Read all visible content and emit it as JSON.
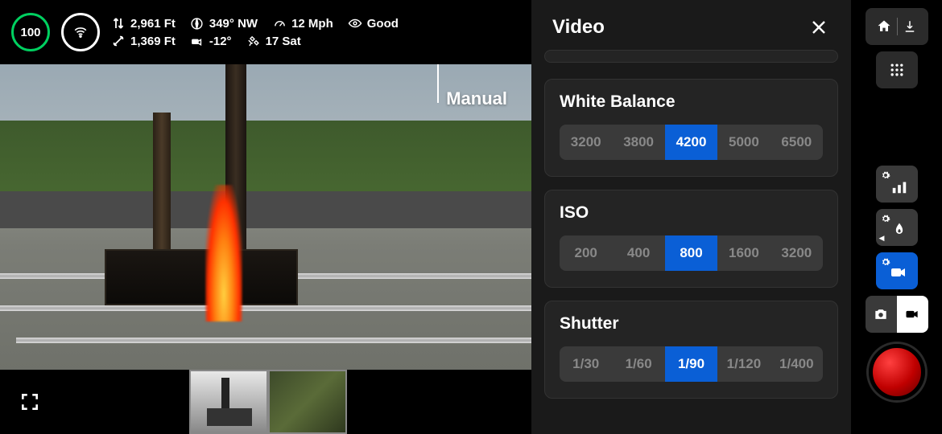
{
  "telemetry": {
    "battery": "100",
    "altitude": "2,961 Ft",
    "distance": "1,369 Ft",
    "heading": "349° NW",
    "gimbal": "-12°",
    "speed": "12 Mph",
    "satellites": "17 Sat",
    "signal": "Good"
  },
  "feed": {
    "mode_label": "Manual"
  },
  "panel": {
    "title": "Video",
    "groups": {
      "white_balance": {
        "label": "White Balance",
        "options": [
          "3200",
          "3800",
          "4200",
          "5000",
          "6500"
        ],
        "selected": "4200"
      },
      "iso": {
        "label": "ISO",
        "options": [
          "200",
          "400",
          "800",
          "1600",
          "3200"
        ],
        "selected": "800"
      },
      "shutter": {
        "label": "Shutter",
        "options": [
          "1/30",
          "1/60",
          "1/90",
          "1/120",
          "1/400"
        ],
        "selected": "1/90"
      }
    }
  },
  "colors": {
    "accent": "#0a5fd6",
    "battery_ring": "#00d060",
    "record": "#d01010"
  }
}
